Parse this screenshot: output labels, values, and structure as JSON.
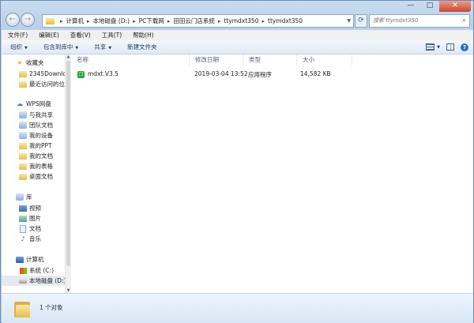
{
  "window": {
    "controls": {
      "minimize": "—",
      "maximize": "□",
      "close": "✕"
    }
  },
  "nav": {
    "back": "←",
    "forward": "→"
  },
  "address": {
    "separator": "▸",
    "segments": [
      "计算机",
      "本地磁盘 (D:)",
      "PC下载网",
      "田田云门店系统",
      "ttymdxt350",
      "ttymdxt350"
    ]
  },
  "search": {
    "placeholder": "搜索 ttymdxt350"
  },
  "menu": [
    "文件(F)",
    "编辑(E)",
    "查看(V)",
    "工具(T)",
    "帮助(H)"
  ],
  "toolbar": {
    "organize": "组织",
    "include_in_library": "包含到库中",
    "share": "共享",
    "new_folder": "新建文件夹"
  },
  "sidebar": {
    "favorites": {
      "label": "收藏夹",
      "items": [
        "2345Downloads",
        "最近访问的位置"
      ]
    },
    "wps": {
      "label": "WPS网盘",
      "items": [
        "与我共享",
        "团队文档",
        "我的设备",
        "我的PPT",
        "我的文档",
        "我的表格",
        "桌面文档"
      ]
    },
    "libraries": {
      "label": "库",
      "items": [
        "视频",
        "图片",
        "文档",
        "音乐"
      ]
    },
    "computer": {
      "label": "计算机",
      "items": [
        "系统 (C:)",
        "本地磁盘 (D:)"
      ]
    }
  },
  "columns": {
    "name": "名称",
    "date": "修改日期",
    "type": "类型",
    "size": "大小"
  },
  "files": [
    {
      "name": "mdxt.V3.5",
      "date": "2019-03-04 13:52",
      "type": "应用程序",
      "size": "14,582 KB"
    }
  ],
  "status": {
    "text": "1 个对象"
  },
  "colors": {
    "window_frame": "#bcd2ea",
    "selected_row": "#e5eaf1",
    "app_icon": "#2ba245"
  }
}
